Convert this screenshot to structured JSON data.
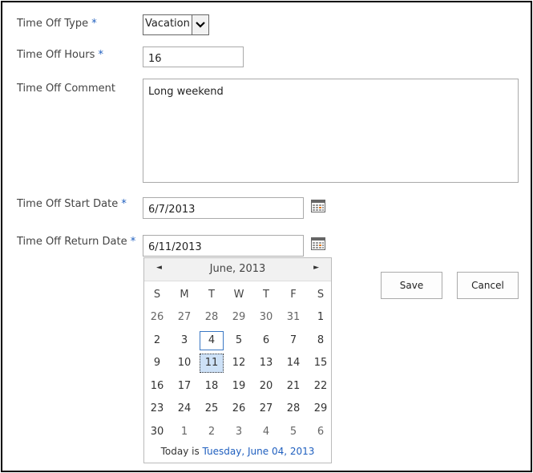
{
  "form": {
    "type_label": "Time Off Type",
    "type_value": "Vacation",
    "hours_label": "Time Off Hours",
    "hours_value": "16",
    "comment_label": "Time Off Comment",
    "comment_value": "Long weekend",
    "start_label": "Time Off Start Date",
    "start_value": "6/7/2013",
    "return_label": "Time Off Return Date",
    "return_value": "6/11/2013",
    "required_mark": "*"
  },
  "buttons": {
    "save": "Save",
    "cancel": "Cancel"
  },
  "calendar": {
    "month_title": "June, 2013",
    "prev": "◄",
    "next": "►",
    "days_of_week": [
      "S",
      "M",
      "T",
      "W",
      "T",
      "F",
      "S"
    ],
    "weeks": [
      [
        "26",
        "27",
        "28",
        "29",
        "30",
        "31",
        "1"
      ],
      [
        "2",
        "3",
        "4",
        "5",
        "6",
        "7",
        "8"
      ],
      [
        "9",
        "10",
        "11",
        "12",
        "13",
        "14",
        "15"
      ],
      [
        "16",
        "17",
        "18",
        "19",
        "20",
        "21",
        "22"
      ],
      [
        "23",
        "24",
        "25",
        "26",
        "27",
        "28",
        "29"
      ],
      [
        "30",
        "1",
        "2",
        "3",
        "4",
        "5",
        "6"
      ]
    ],
    "today_prefix": "Today is",
    "today_link": "Tuesday, June 04, 2013"
  },
  "icons": {
    "calendar": "calendar-icon",
    "dropdown": "chevron-down-icon"
  }
}
